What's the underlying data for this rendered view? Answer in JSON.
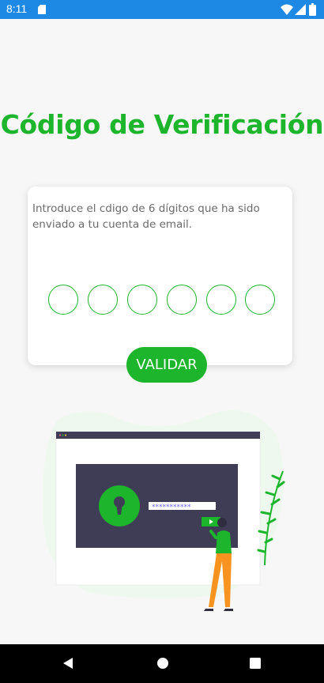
{
  "status_bar": {
    "time": "8:11",
    "icons": [
      "sd-card-icon",
      "wifi-icon",
      "signal-icon",
      "battery-icon"
    ]
  },
  "title": "Código de Verificación",
  "card": {
    "instruction": "Introduce el cdigo de 6 dígitos que ha sido enviado a tu cuenta de email.",
    "code_digits": [
      "",
      "",
      "",
      "",
      "",
      ""
    ]
  },
  "validate_label": "VALIDAR",
  "illustration": {
    "password_mask": "***********"
  },
  "nav_bar": {
    "icons": [
      "back-icon",
      "home-icon",
      "recents-icon"
    ]
  },
  "colors": {
    "accent": "#1cb52c",
    "status_bar": "#1e88e5",
    "background": "#f7f7f7"
  }
}
